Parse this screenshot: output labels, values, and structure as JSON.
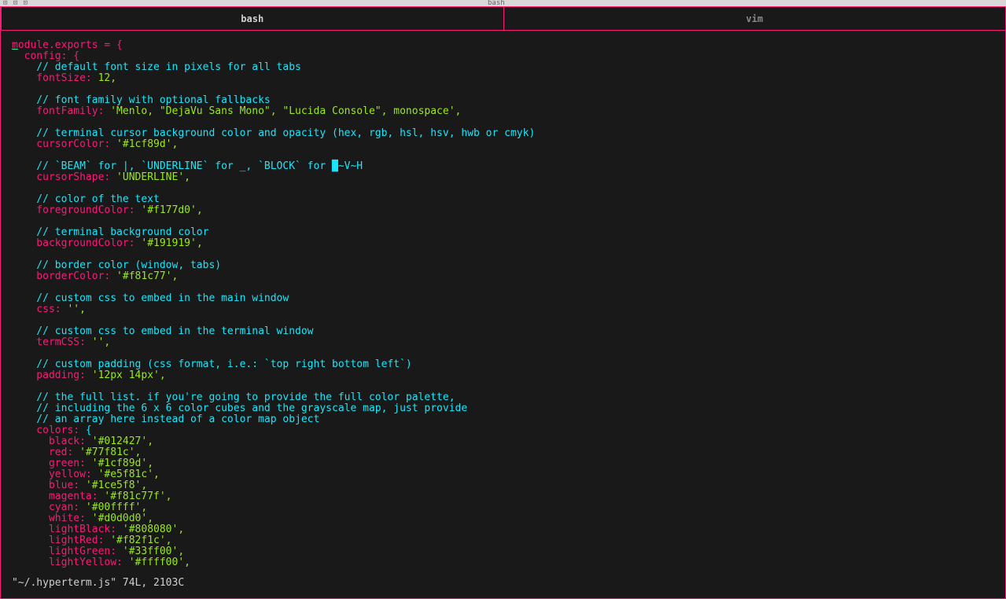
{
  "chrome": {
    "dots": "⊡ ⊡ ⊡",
    "bg_tab": "bash"
  },
  "tabs": [
    {
      "label": "bash",
      "active": true
    },
    {
      "label": "vim",
      "active": false
    }
  ],
  "code": {
    "l1a": "m",
    "l1b": "odule.exports = {",
    "l2": "  config: {",
    "l3": "    // default font size in pixels for all tabs",
    "l4k": "    fontSize:",
    "l4v": " 12,",
    "l5": "",
    "l6": "    // font family with optional fallbacks",
    "l7k": "    fontFamily:",
    "l7v": " 'Menlo, \"DejaVu Sans Mono\", \"Lucida Console\", monospace',",
    "l8": "",
    "l9": "    // terminal cursor background color and opacity (hex, rgb, hsl, hsv, hwb or cmyk)",
    "l10k": "    cursorColor:",
    "l10v": " '#1cf89d',",
    "l11": "",
    "l12": "    // `BEAM` for |, `UNDERLINE` for _, `BLOCK` for █~V~H",
    "l13k": "    cursorShape:",
    "l13v": " 'UNDERLINE',",
    "l14": "",
    "l15": "    // color of the text",
    "l16k": "    foregroundColor:",
    "l16v": " '#f177d0',",
    "l17": "",
    "l18": "    // terminal background color",
    "l19k": "    backgroundColor:",
    "l19v": " '#191919',",
    "l20": "",
    "l21": "    // border color (window, tabs)",
    "l22k": "    borderColor:",
    "l22v": " '#f81c77',",
    "l23": "",
    "l24": "    // custom css to embed in the main window",
    "l25k": "    css:",
    "l25v": " '',",
    "l26": "",
    "l27": "    // custom css to embed in the terminal window",
    "l28k": "    termCSS:",
    "l28v": " '',",
    "l29": "",
    "l30": "    // custom padding (css format, i.e.: `top right bottom left`)",
    "l31k": "    padding:",
    "l31v": " '12px 14px',",
    "l32": "",
    "l33": "    // the full list. if you're going to provide the full color palette,",
    "l34": "    // including the 6 x 6 color cubes and the grayscale map, just provide",
    "l35": "    // an array here instead of a color map object",
    "l36k": "    colors:",
    "l36v": " {",
    "l37k": "      black:",
    "l37v": " '#012427',",
    "l38k": "      red:",
    "l38v": " '#77f81c',",
    "l39k": "      green:",
    "l39v": " '#1cf89d',",
    "l40k": "      yellow:",
    "l40v": " '#e5f81c',",
    "l41k": "      blue:",
    "l41v": " '#1ce5f8',",
    "l42k": "      magenta:",
    "l42v": " '#f81c77f',",
    "l43k": "      cyan:",
    "l43v": " '#00ffff',",
    "l44k": "      white:",
    "l44v": " '#d0d0d0',",
    "l45k": "      lightBlack:",
    "l45v": " '#808080',",
    "l46k": "      lightRed:",
    "l46v": " '#f82f1c',",
    "l47k": "      lightGreen:",
    "l47v": " '#33ff00',",
    "l48k": "      lightYellow:",
    "l48v": " '#ffff00',"
  },
  "status": "\"~/.hyperterm.js\" 74L, 2103C",
  "colors": {
    "border": "#f81c77",
    "bg": "#191919",
    "fg": "#f177d0",
    "cursor": "#1cf89d",
    "comment": "#1ce5f8",
    "key": "#f81c77",
    "string": "#9be81c"
  }
}
